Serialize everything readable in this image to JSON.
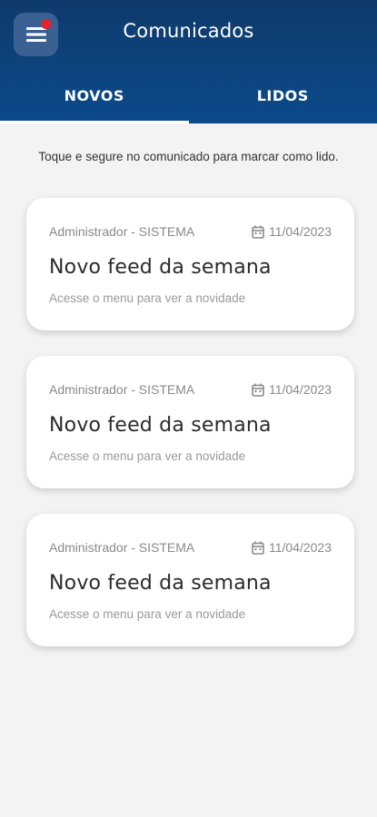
{
  "header": {
    "title": "Comunicados",
    "colors": {
      "background": "#0c4a8c",
      "menu_button": "#3a6192",
      "notification_dot": "#e8202d"
    },
    "menu_icon": "menu-icon"
  },
  "tabs": [
    {
      "label": "NOVOS",
      "active": true
    },
    {
      "label": "LIDOS",
      "active": false
    }
  ],
  "hint": "Toque e segure no comunicado para marcar como lido.",
  "cards": [
    {
      "author": "Administrador - SISTEMA",
      "date": "11/04/2023",
      "title": "Novo feed da semana",
      "description": "Acesse o menu para ver a novidade"
    },
    {
      "author": "Administrador - SISTEMA",
      "date": "11/04/2023",
      "title": "Novo feed da semana",
      "description": "Acesse o menu para ver a novidade"
    },
    {
      "author": "Administrador - SISTEMA",
      "date": "11/04/2023",
      "title": "Novo feed da semana",
      "description": "Acesse o menu para ver a novidade"
    }
  ]
}
